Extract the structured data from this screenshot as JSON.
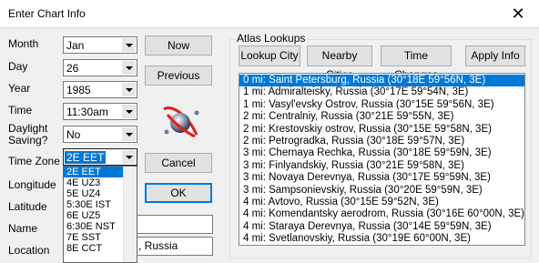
{
  "window": {
    "title": "Enter Chart Info",
    "close_glyph": "✕"
  },
  "form": {
    "month": {
      "label": "Month",
      "value": "Jan"
    },
    "day": {
      "label": "Day",
      "value": "26"
    },
    "year": {
      "label": "Year",
      "value": "1985"
    },
    "time": {
      "label": "Time",
      "value": "11:30am"
    },
    "dst": {
      "label_line1": "Daylight",
      "label_line2": "Saving?",
      "value": "No"
    },
    "timezone": {
      "label": "Time Zone",
      "value": "2E EET",
      "options": [
        "2E EET",
        "4E UZ3",
        "5E UZ4",
        "5:30E IST",
        "6E UZ5",
        "6:30E NST",
        "7E SST",
        "8E CCT"
      ],
      "selected_index": 0
    },
    "longitude": {
      "label": "Longitude"
    },
    "latitude": {
      "label": "Latitude"
    },
    "name": {
      "label": "Name"
    },
    "location": {
      "label": "Location",
      "value_visible": ", Russia"
    }
  },
  "buttons": {
    "now": "Now",
    "previous": "Previous",
    "cancel": "Cancel",
    "ok": "OK"
  },
  "atlas": {
    "group_title": "Atlas Lookups",
    "lookup_city": "Lookup City",
    "nearby_cities": "Nearby Cities",
    "time_changes": "Time Changes",
    "apply_info": "Apply Info",
    "results": [
      "0 mi: Saint Petersburg, Russia (30°18E 59°56N, 3E)",
      "1 mi: Admiralteisky, Russia (30°17E 59°54N, 3E)",
      "1 mi: Vasyl'evsky Ostrov, Russia (30°15E 59°56N, 3E)",
      "2 mi: Centralniy, Russia (30°21E 59°55N, 3E)",
      "2 mi: Krestovskiy ostrov, Russia (30°15E 59°58N, 3E)",
      "2 mi: Petrogradka, Russia (30°18E 59°57N, 3E)",
      "3 mi: Chernaya Rechka, Russia (30°18E 59°59N, 3E)",
      "3 mi: Finlyandskiy, Russia (30°21E 59°58N, 3E)",
      "3 mi: Novaya Derevnya, Russia (30°17E 59°59N, 3E)",
      "3 mi: Sampsonievskiy, Russia (30°20E 59°59N, 3E)",
      "4 mi: Avtovo, Russia (30°15E 59°52N, 3E)",
      "4 mi: Komendantsky aerodrom, Russia (30°16E 60°00N, 3E)",
      "4 mi: Staraya Derevnya, Russia (30°14E 59°59N, 3E)",
      "4 mi: Svetlanovskiy, Russia (30°19E 60°00N, 3E)"
    ],
    "selected_index": 0
  },
  "colors": {
    "selection": "#0078d7",
    "planet_ring": "#e0201a",
    "window_bg": "#f0f0f0"
  },
  "icons": {
    "logo": "planet-logo-icon"
  }
}
